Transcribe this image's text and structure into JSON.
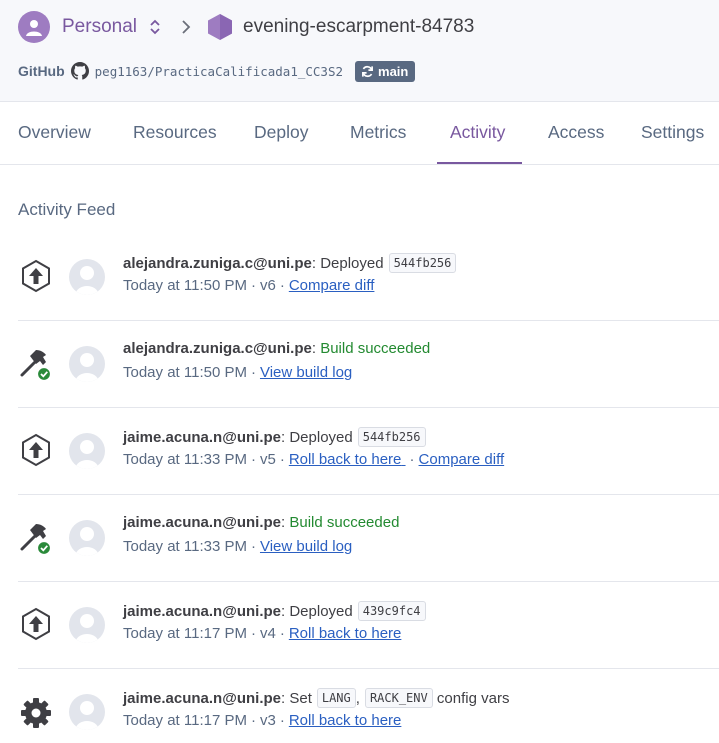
{
  "header": {
    "team": "Personal",
    "app_name": "evening-escarpment-84783",
    "github_label": "GitHub",
    "repo": "peg1163/PracticaCalificada1_CC3S2",
    "branch": "main"
  },
  "tabs": [
    "Overview",
    "Resources",
    "Deploy",
    "Metrics",
    "Activity",
    "Access",
    "Settings"
  ],
  "active_tab": "Activity",
  "feed": {
    "title": "Activity Feed",
    "items": [
      {
        "icon": "deploy-icon",
        "user": "alejandra.zuniga.c@uni.pe",
        "sep": ":",
        "action": "Deployed",
        "sha": "544fb256",
        "time": "Today at 11:50 PM",
        "version": "v6",
        "link1": "Compare diff"
      },
      {
        "icon": "build-success-icon",
        "user": "alejandra.zuniga.c@uni.pe",
        "sep": ":",
        "action": "Build succeeded",
        "time": "Today at 11:50 PM",
        "link1": "View build log"
      },
      {
        "icon": "deploy-icon",
        "user": "jaime.acuna.n@uni.pe",
        "sep": ":",
        "action": "Deployed",
        "sha": "544fb256",
        "time": "Today at 11:33 PM",
        "version": "v5",
        "link1": "Roll back to here",
        "link2": "Compare diff"
      },
      {
        "icon": "build-success-icon",
        "user": "jaime.acuna.n@uni.pe",
        "sep": ":",
        "action": "Build succeeded",
        "time": "Today at 11:33 PM",
        "link1": "View build log"
      },
      {
        "icon": "deploy-icon",
        "user": "jaime.acuna.n@uni.pe",
        "sep": ":",
        "action": "Deployed",
        "sha": "439c9fc4",
        "time": "Today at 11:17 PM",
        "version": "v4",
        "link1": "Roll back to here"
      },
      {
        "icon": "config-gear-icon",
        "user": "jaime.acuna.n@uni.pe",
        "sep": ":",
        "action": "Set",
        "var1": "LANG",
        "comma": ",",
        "var2": "RACK_ENV",
        "action_suffix": "config vars",
        "time": "Today at 11:17 PM",
        "version": "v3",
        "link1": "Roll back to here"
      }
    ]
  },
  "colors": {
    "accent": "#79589f",
    "link": "#2a5fc1",
    "success": "#238a31",
    "muted": "#596981"
  }
}
